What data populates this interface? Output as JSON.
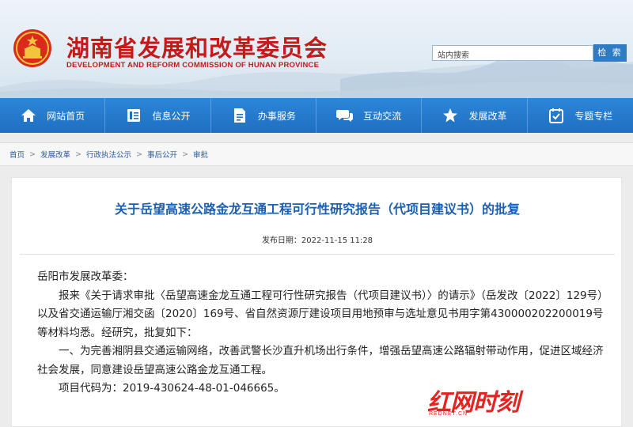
{
  "header": {
    "title_cn": "湖南省发展和改革委员会",
    "title_en": "DEVELOPMENT AND REFORM COMMISSION OF HUNAN PROVINCE",
    "search_placeholder": "站内搜索",
    "search_button": "检 索",
    "brand_color": "#c41a1a"
  },
  "nav": {
    "items": [
      {
        "label": "网站首页",
        "icon": "home-icon"
      },
      {
        "label": "信息公开",
        "icon": "document-icon"
      },
      {
        "label": "办事服务",
        "icon": "file-icon"
      },
      {
        "label": "互动交流",
        "icon": "chat-icon"
      },
      {
        "label": "发展改革",
        "icon": "star-icon"
      },
      {
        "label": "专题专栏",
        "icon": "checklist-icon"
      }
    ],
    "color": "#1e6fc2"
  },
  "breadcrumb": [
    "首页",
    "发展改革",
    "行政执法公示",
    "事后公开",
    "审批"
  ],
  "article": {
    "title": "关于岳望高速公路金龙互通工程可行性研究报告（代项目建议书）的批复",
    "pubdate": "发布日期：2022-11-15 11:28",
    "salutation": "岳阳市发展改革委：",
    "p1": "报来《关于请求审批〈岳望高速金龙互通工程可行性研究报告（代项目建议书）〉的请示》（岳发改〔2022〕129号）以及省交通运输厅湘交函〔2020〕169号、省自然资源厅建设项目用地预审与选址意见书用字第430000202200019号等材料均悉。经研究，批复如下：",
    "p2": "一、为完善湘阴县交通运输网络，改善武警长沙直升机场出行条件，增强岳望高速公路辐射带动作用，促进区域经济社会发展，同意建设岳望高速公路金龙互通工程。",
    "p3": "项目代码为：2019-430624-48-01-046665。"
  },
  "watermark": {
    "text": "红网时刻",
    "sub": "REDNET.CN"
  }
}
